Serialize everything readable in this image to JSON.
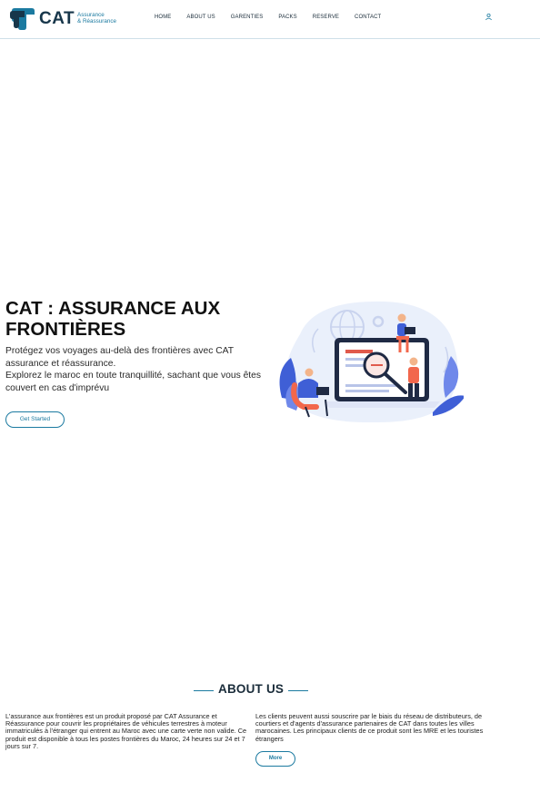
{
  "brand": {
    "name": "CAT",
    "tagline_line1": "Assurance",
    "tagline_line2": "& Réassurance",
    "color_primary": "#17364a",
    "color_accent": "#1b7aa0"
  },
  "nav": {
    "items": [
      {
        "label": "HOME"
      },
      {
        "label": "ABOUT US"
      },
      {
        "label": "GARENTIES"
      },
      {
        "label": "PACKS"
      },
      {
        "label": "RESERVE"
      },
      {
        "label": "CONTACT"
      }
    ],
    "user_icon": "user-icon"
  },
  "hero": {
    "title": "CAT : ASSURANCE AUX FRONTIÈRES",
    "paragraph_1": "Protégez vos voyages au-delà des frontières avec CAT assurance et réassurance.",
    "paragraph_2": "Explorez le maroc en toute tranquillité, sachant que vous êtes couvert en cas d'imprévu",
    "cta_label": "Get Started",
    "illustration": "insurance-search-illustration"
  },
  "about": {
    "title": "ABOUT US",
    "col1_text": "L'assurance aux frontières est un produit proposé par CAT Assurance et Réassurance pour couvrir les propriétaires de véhicules terrestres à moteur immatriculés à l'étranger qui entrent au Maroc avec une carte verte non valide. Ce produit est disponible à tous les postes frontières du Maroc, 24 heures sur 24 et 7 jours sur 7.",
    "col2_text": "Les clients peuvent aussi souscrire par le biais du réseau de distributeurs, de courtiers et d'agents d'assurance partenaires de CAT dans toutes les villes marocaines. Les principaux clients de ce produit sont les MRE et les touristes étrangers",
    "more_label": "More"
  }
}
